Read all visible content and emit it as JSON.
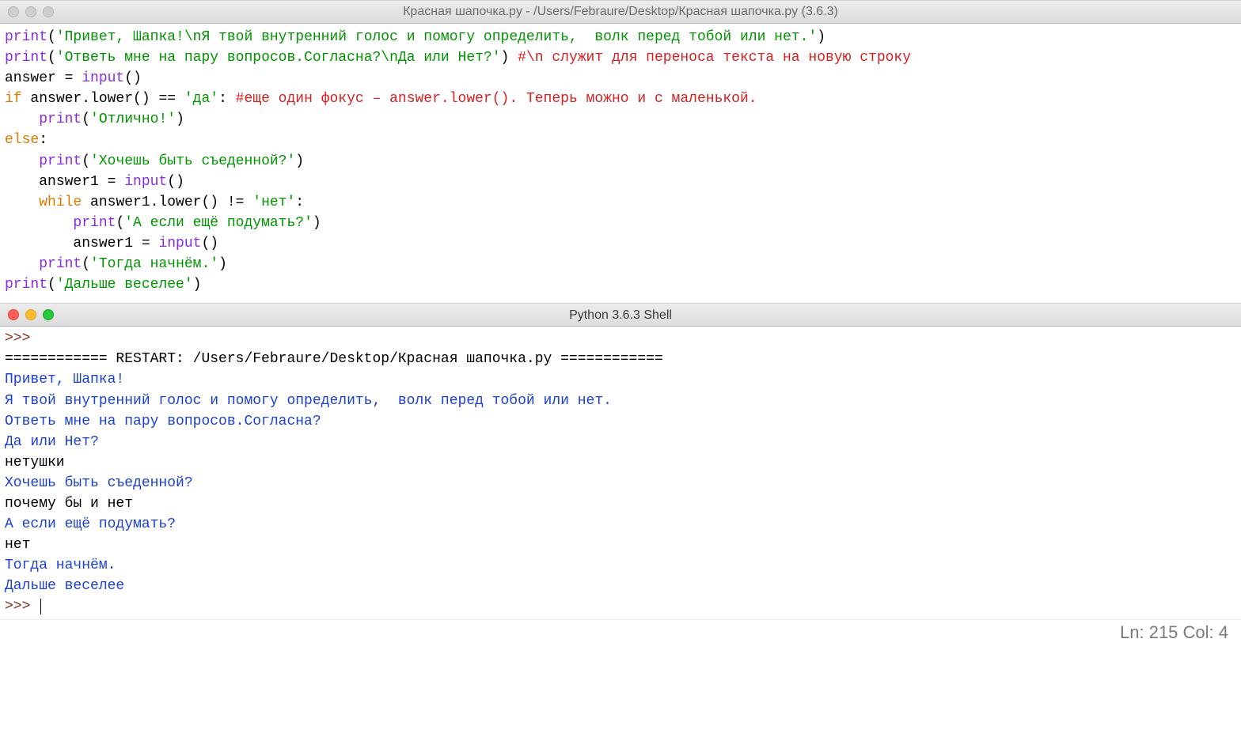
{
  "editor": {
    "title": "Красная шапочка.py - /Users/Febraure/Desktop/Красная шапочка.py (3.6.3)",
    "code": {
      "l1": {
        "p": "print",
        "po": "(",
        "s": "'Привет, Шапка!\\nЯ твой внутренний голос и помогу определить,  волк перед тобой или нет.'",
        "pc": ")"
      },
      "l2": {
        "p": "print",
        "po": "(",
        "s": "'Ответь мне на пару вопросов.Согласна?\\nДа или Нет?'",
        "pc": ") ",
        "c": "#\\n служит для переноса текста на новую строку"
      },
      "l3": {
        "a": "answer = ",
        "fn": "input",
        "b": "()"
      },
      "l4": {
        "kw": "if",
        "a": " answer.lower() == ",
        "s": "'да'",
        "col": ": ",
        "c": "#еще один фокус – answer.lower(). Теперь можно и с маленькой."
      },
      "l5": {
        "ind": "    ",
        "p": "print",
        "po": "(",
        "s": "'Отлично!'",
        "pc": ")"
      },
      "l6": {
        "kw": "else",
        "col": ":"
      },
      "l7": {
        "ind": "    ",
        "p": "print",
        "po": "(",
        "s": "'Хочешь быть съеденной?'",
        "pc": ")"
      },
      "l8": {
        "ind": "    ",
        "a": "answer1 = ",
        "fn": "input",
        "b": "()"
      },
      "l9": {
        "ind": "    ",
        "kw": "while",
        "a": " answer1.lower() != ",
        "s": "'нет'",
        "col": ":"
      },
      "l10": {
        "ind": "        ",
        "p": "print",
        "po": "(",
        "s": "'А если ещё подумать?'",
        "pc": ")"
      },
      "l11": {
        "ind": "        ",
        "a": "answer1 = ",
        "fn": "input",
        "b": "()"
      },
      "l12": {
        "ind": "    ",
        "p": "print",
        "po": "(",
        "s": "'Тогда начнём.'",
        "pc": ")"
      },
      "l13": {
        "p": "print",
        "po": "(",
        "s": "'Дальше веселее'",
        "pc": ")"
      }
    }
  },
  "shell": {
    "title": "Python 3.6.3 Shell",
    "truncated_top": "⋯",
    "prompt": ">>> ",
    "restart": "============ RESTART: /Users/Febraure/Desktop/Красная шапочка.py ============",
    "out1": "Привет, Шапка!",
    "out2": "Я твой внутренний голос и помогу определить,  волк перед тобой или нет.",
    "out3": "Ответь мне на пару вопросов.Согласна?",
    "out4": "Да или Нет?",
    "in1": "нетушки",
    "out5": "Хочешь быть съеденной?",
    "in2": "почему бы и нет",
    "out6": "А если ещё подумать?",
    "in3": "нет",
    "out7": "Тогда начнём.",
    "out8": "Дальше веселее"
  },
  "status": {
    "text": "Ln: 215  Col: 4"
  }
}
